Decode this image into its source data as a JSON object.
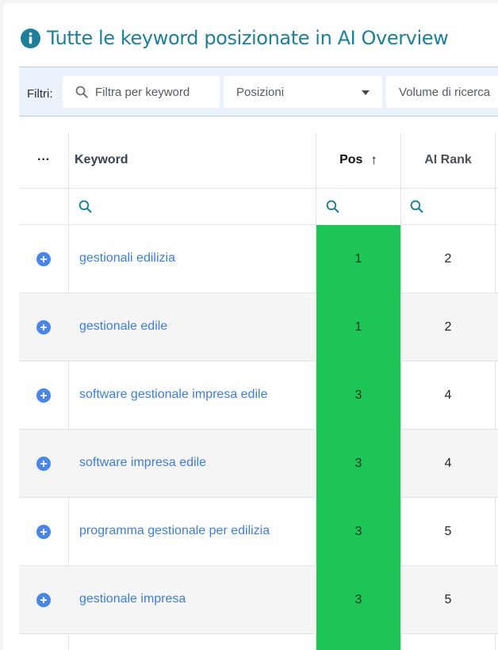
{
  "title": "Tutte le keyword posizionate in AI Overview",
  "filters": {
    "label": "Filtri:",
    "keyword_placeholder": "Filtra per keyword",
    "positions_label": "Posizioni",
    "volume_label": "Volume di ricerca"
  },
  "table": {
    "columns": {
      "menu": "···",
      "keyword": "Keyword",
      "pos": "Pos",
      "pos_sort_arrow": "↑",
      "ai_rank": "AI Rank"
    },
    "rows": [
      {
        "keyword": "gestionali edilizia",
        "pos": "1",
        "ai_rank": "2"
      },
      {
        "keyword": "gestionale edile",
        "pos": "1",
        "ai_rank": "2"
      },
      {
        "keyword": "software gestionale impresa edile",
        "pos": "3",
        "ai_rank": "4"
      },
      {
        "keyword": "software impresa edile",
        "pos": "3",
        "ai_rank": "4"
      },
      {
        "keyword": "programma gestionale per edilizia",
        "pos": "3",
        "ai_rank": "5"
      },
      {
        "keyword": "gestionale impresa",
        "pos": "3",
        "ai_rank": "5"
      }
    ]
  },
  "colors": {
    "title": "#1d7f99",
    "link": "#3d7fd6",
    "position_good": "#1dc456",
    "expand_icon": "#4a86e8"
  },
  "icons": [
    "info-icon",
    "search-icon",
    "chevron-down-icon",
    "plus-circle-icon"
  ]
}
